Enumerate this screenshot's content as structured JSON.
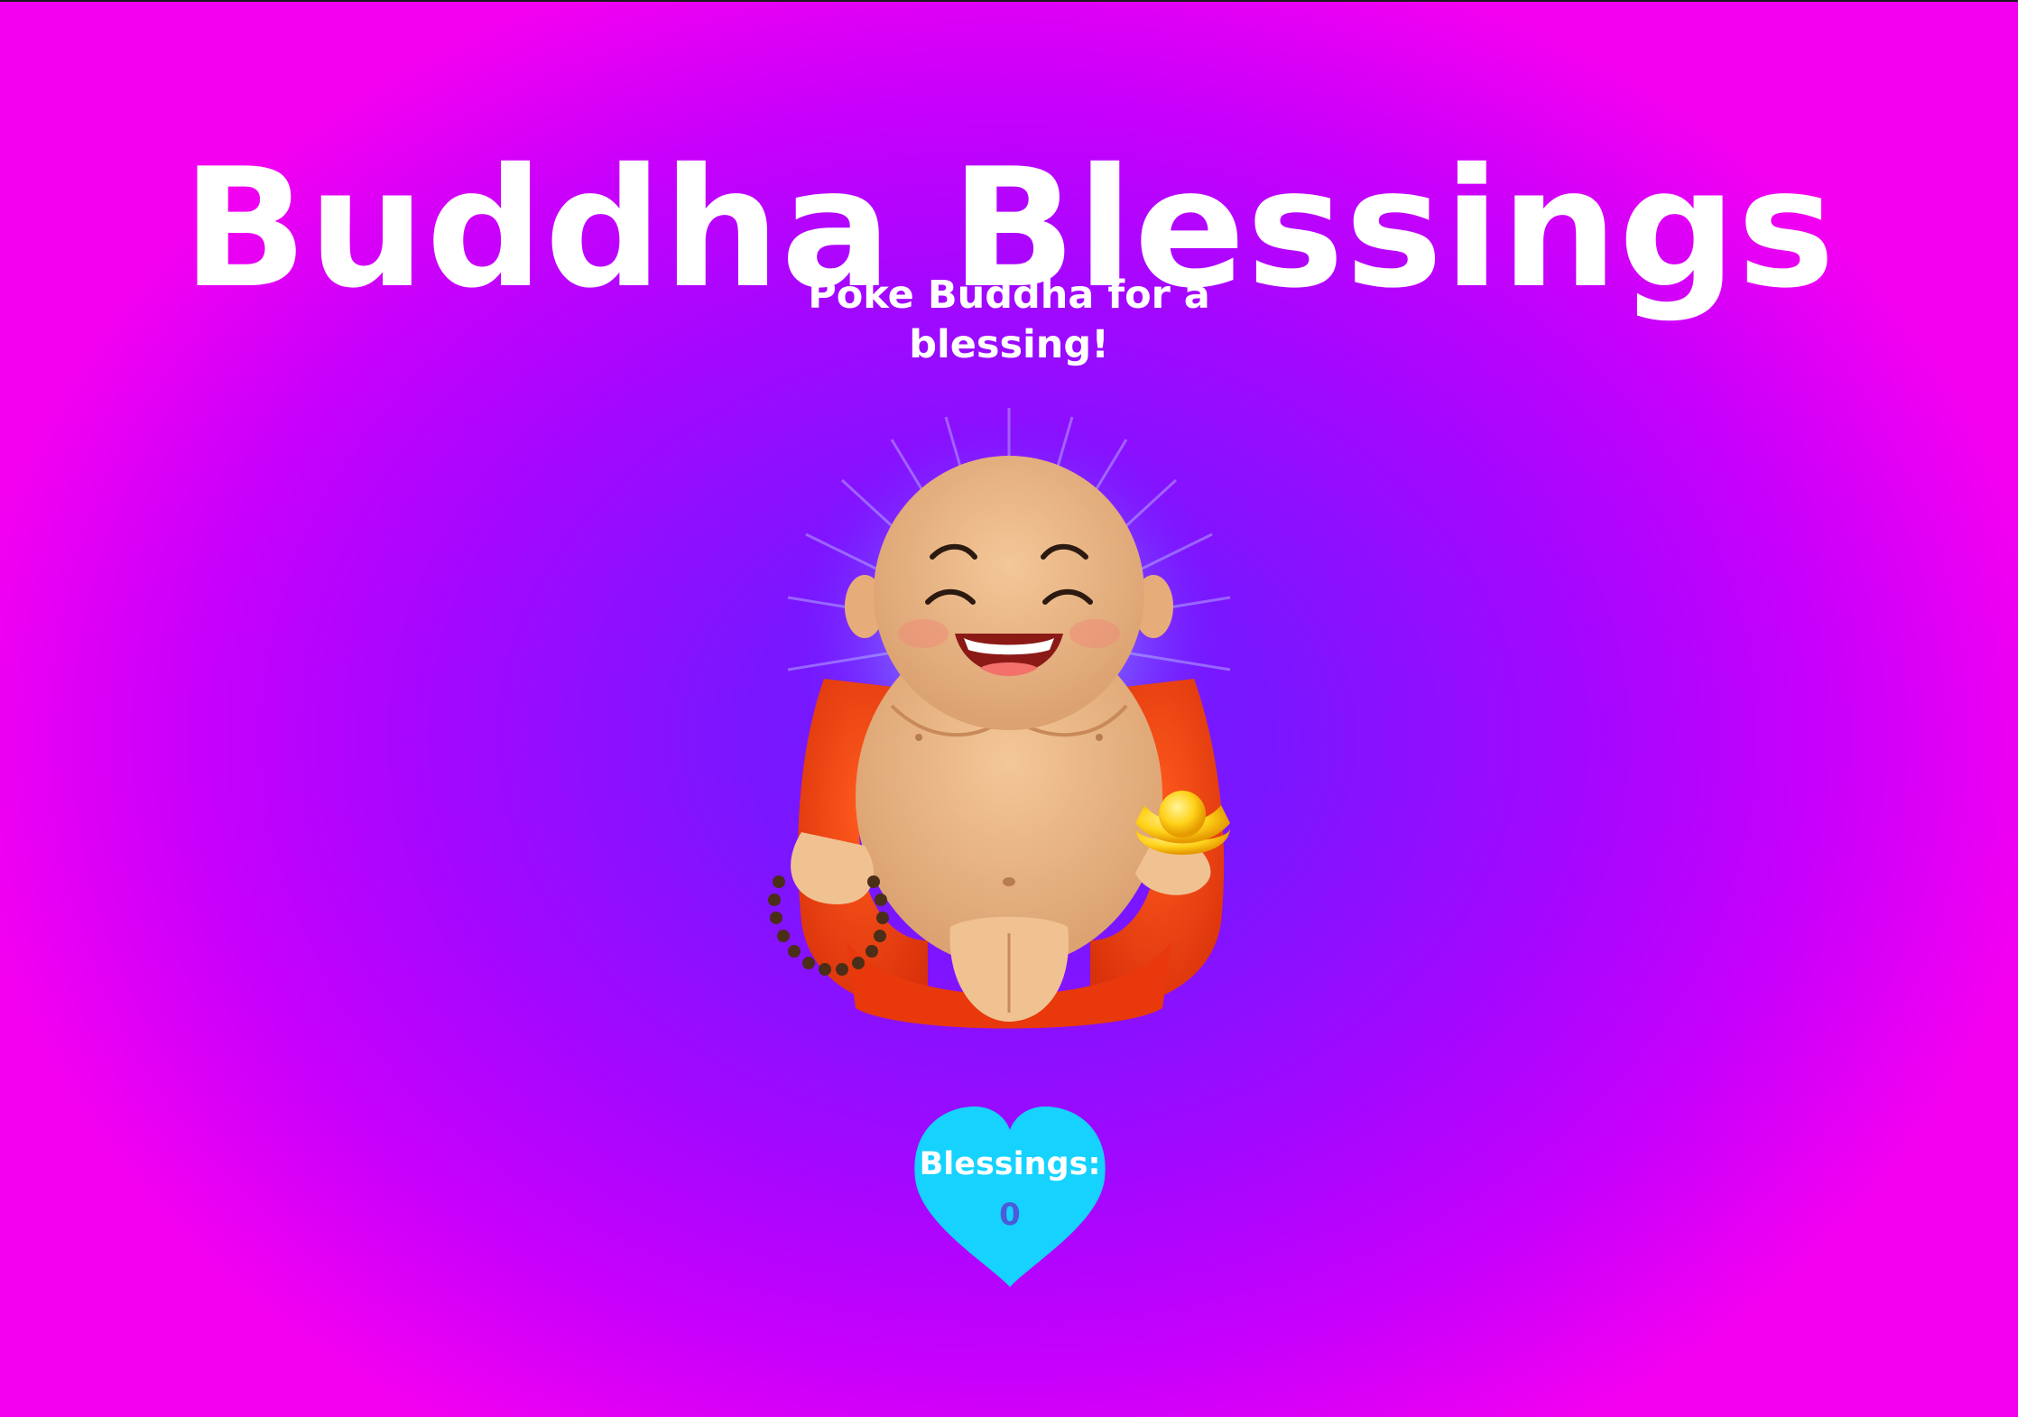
{
  "app": {
    "title": "Buddha Blessings",
    "subtitle": "Poke Buddha for a blessing!"
  },
  "buddha": {
    "icon": "laughing-buddha-icon",
    "robe_color": "#f2400f",
    "skin_color": "#efb98a",
    "halo_color": "#9ab6ff"
  },
  "counter": {
    "label": "Blessings:",
    "value": "0",
    "heart_color": "#16d2ff"
  },
  "colors": {
    "background_center": "#6a1eff",
    "background_edge": "#f400f0",
    "text": "#ffffff",
    "count_text": "#4b5bd9"
  }
}
